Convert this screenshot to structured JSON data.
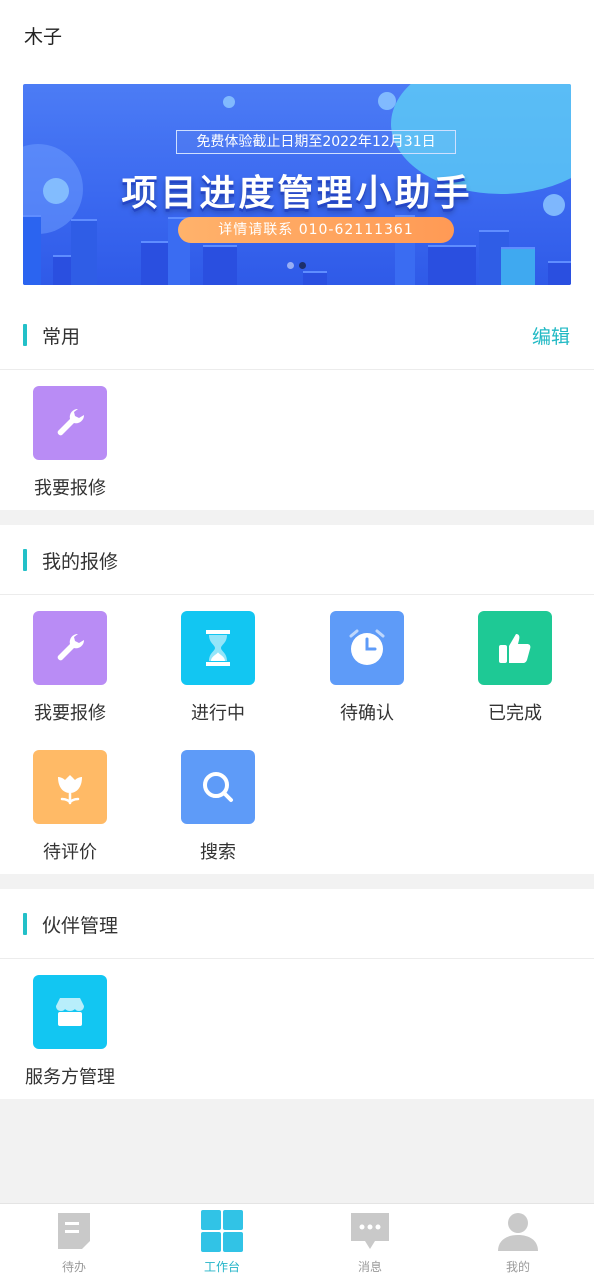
{
  "header": {
    "user_name": "木子"
  },
  "banner": {
    "subtitle": "免费体验截止日期至2022年12月31日",
    "title": "项目进度管理小助手",
    "contact": "详情请联系 010-62111361"
  },
  "common": {
    "title": "常用",
    "action": "编辑",
    "items": [
      {
        "label": "我要报修",
        "icon": "wrench-icon",
        "color": "#b98cf5"
      }
    ]
  },
  "repairs": {
    "title": "我的报修",
    "items": [
      {
        "label": "我要报修",
        "icon": "wrench-icon",
        "color": "#b98cf5"
      },
      {
        "label": "进行中",
        "icon": "hourglass-icon",
        "color": "#12c6f2"
      },
      {
        "label": "待确认",
        "icon": "clock-icon",
        "color": "#5e9bf8"
      },
      {
        "label": "已完成",
        "icon": "thumbs-up-icon",
        "color": "#1ec995"
      },
      {
        "label": "待评价",
        "icon": "flower-icon",
        "color": "#ffba66"
      },
      {
        "label": "搜索",
        "icon": "search-icon",
        "color": "#5e9bf8"
      }
    ]
  },
  "partners": {
    "title": "伙伴管理",
    "items": [
      {
        "label": "服务方管理",
        "icon": "store-icon",
        "color": "#12c6f2"
      }
    ]
  },
  "tabbar": {
    "items": [
      {
        "label": "待办",
        "icon": "document-icon",
        "active": false
      },
      {
        "label": "工作台",
        "icon": "grid-icon",
        "active": true
      },
      {
        "label": "消息",
        "icon": "chat-icon",
        "active": false
      },
      {
        "label": "我的",
        "icon": "person-icon",
        "active": false
      }
    ]
  },
  "colors": {
    "accent": "#23c0c8",
    "background": "#f2f2f2"
  }
}
